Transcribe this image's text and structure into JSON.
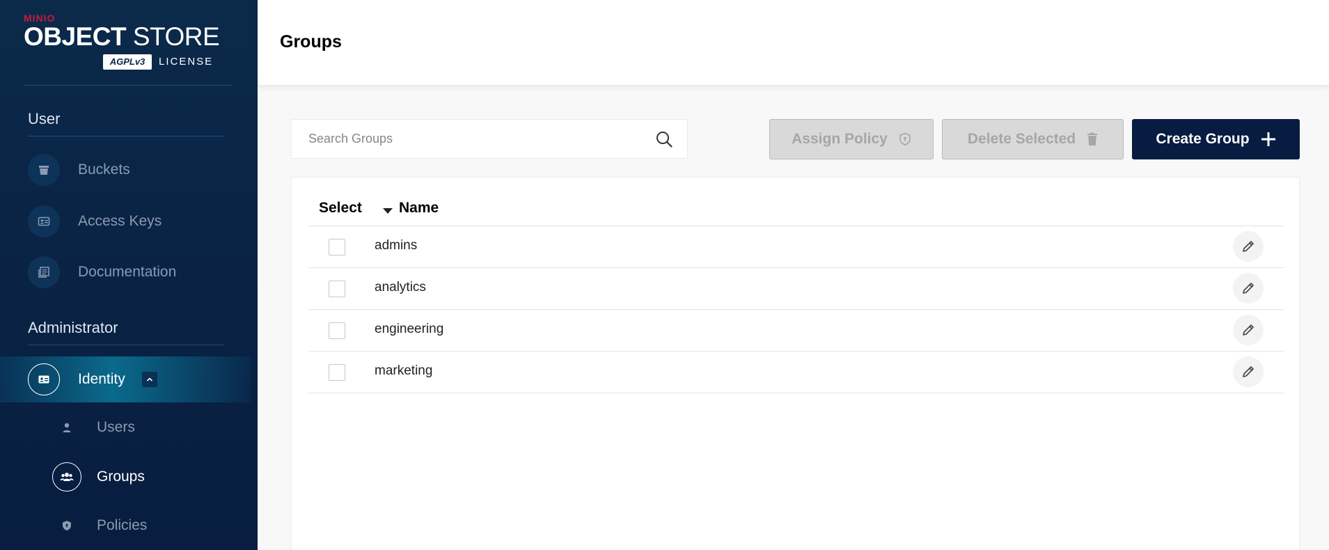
{
  "brand": {
    "company": "MINIO",
    "title_bold": "OBJECT",
    "title_light": "STORE",
    "badge": "AGPLv3",
    "license": "LICENSE"
  },
  "sidebar": {
    "user_section": "User",
    "user_items": [
      {
        "label": "Buckets",
        "icon": "bucket-icon"
      },
      {
        "label": "Access Keys",
        "icon": "access-keys-icon"
      },
      {
        "label": "Documentation",
        "icon": "documentation-icon"
      }
    ],
    "admin_section": "Administrator",
    "identity": {
      "label": "Identity",
      "icon": "identity-icon",
      "expanded": true
    },
    "identity_items": [
      {
        "label": "Users",
        "icon": "user-icon",
        "active": false
      },
      {
        "label": "Groups",
        "icon": "groups-icon",
        "active": true
      },
      {
        "label": "Policies",
        "icon": "policy-icon",
        "active": false
      }
    ]
  },
  "header": {
    "title": "Groups"
  },
  "toolbar": {
    "search_placeholder": "Search Groups",
    "assign_policy": "Assign Policy",
    "delete_selected": "Delete Selected",
    "create_group": "Create Group"
  },
  "table": {
    "columns": {
      "select": "Select",
      "name": "Name"
    },
    "sort": "Name descending-indicator",
    "rows": [
      {
        "name": "admins",
        "checked": false
      },
      {
        "name": "analytics",
        "checked": false
      },
      {
        "name": "engineering",
        "checked": false
      },
      {
        "name": "marketing",
        "checked": false
      }
    ]
  },
  "colors": {
    "sidebar_bg": "#0a2446",
    "primary": "#081c42",
    "brand_red": "#c51b3a",
    "active_highlight": "#0a6a8c"
  }
}
